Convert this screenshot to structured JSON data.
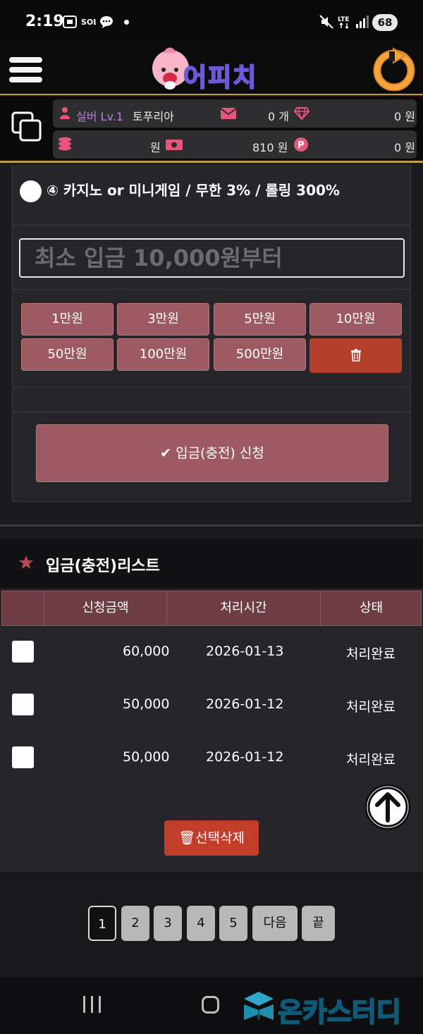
{
  "status_bar": {
    "time": "2:19",
    "battery": "68"
  },
  "header": {
    "logo_text": "어피치"
  },
  "info": {
    "grade": "실버 Lv.1",
    "nickname": "토푸리아",
    "messages": "0 개",
    "gems": "0 원",
    "cash": "원",
    "balance": "810 원",
    "points": "0 원"
  },
  "form": {
    "option_label": "④ 카지노 or 미니게임 / 무한 3% / 롤링 300%",
    "amount_placeholder": "최소 입금 10,000원부터",
    "amount_buttons": [
      "1만원",
      "3만원",
      "5만원",
      "10만원",
      "50만원",
      "100만원",
      "500만원"
    ],
    "submit_label": "✔ 입금(충전) 신청"
  },
  "list": {
    "title": "입금(충전)리스트",
    "columns": [
      "신청금액",
      "처리시간",
      "상태"
    ],
    "rows": [
      {
        "amount": "60,000",
        "time": "2026-01-13",
        "status": "처리완료"
      },
      {
        "amount": "50,000",
        "time": "2026-01-12",
        "status": "처리완료"
      },
      {
        "amount": "50,000",
        "time": "2026-01-12",
        "status": "처리완료"
      }
    ],
    "delete_selected": "🗑선택삭제"
  },
  "pagination": {
    "pages": [
      "1",
      "2",
      "3",
      "4",
      "5"
    ],
    "next": "다음",
    "last": "끝",
    "active_page": "1"
  },
  "watermark": {
    "text": "온카스터디"
  },
  "colors": {
    "accent_gold": "#c49b45",
    "button_rose": "#9e5a62",
    "delete_red": "#b3402d",
    "header_row": "#6e3c44",
    "pink_icon": "#e8557a"
  }
}
